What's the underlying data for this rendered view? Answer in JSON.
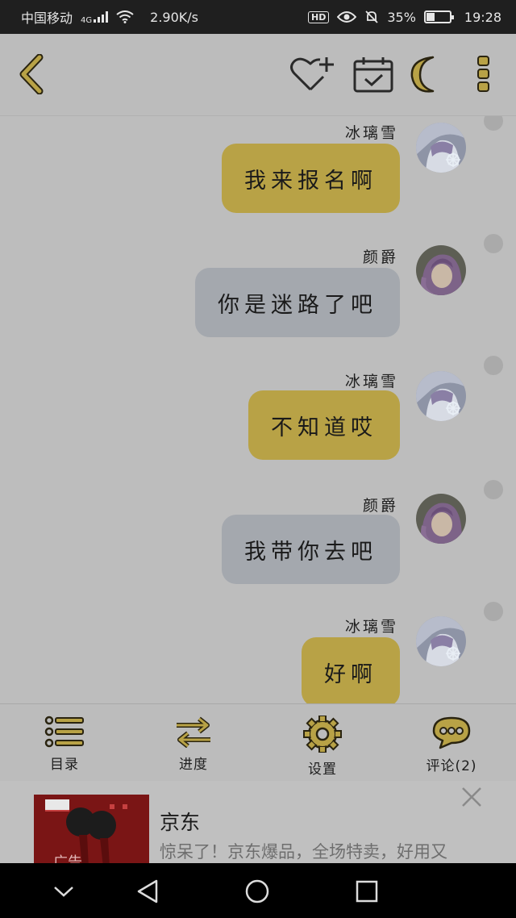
{
  "status_bar": {
    "carrier": "中国移动",
    "network": "4G",
    "speed": "2.90K/s",
    "hd": "HD",
    "battery_percent": "35%",
    "battery_level": 0.35,
    "time": "19:28"
  },
  "toolbar": {
    "icons": [
      "back-chevron-icon",
      "heart-plus-icon",
      "calendar-check-icon",
      "moon-icon",
      "more-vertical-icon"
    ]
  },
  "messages": [
    {
      "sender": "冰璃雪",
      "text": "我来报名啊",
      "side": "me",
      "unread": true
    },
    {
      "sender": "颜爵",
      "text": "你是迷路了吧",
      "side": "other",
      "unread": true
    },
    {
      "sender": "冰璃雪",
      "text": "不知道哎",
      "side": "me",
      "unread": true
    },
    {
      "sender": "颜爵",
      "text": "我带你去吧",
      "side": "other",
      "unread": true
    },
    {
      "sender": "冰璃雪",
      "text": "好啊",
      "side": "me",
      "unread": true
    }
  ],
  "bottom_nav": {
    "items": [
      {
        "label": "目录",
        "icon": "list-icon"
      },
      {
        "label": "进度",
        "icon": "swap-arrows-icon"
      },
      {
        "label": "设置",
        "icon": "gear-icon"
      },
      {
        "label": "评论(2)",
        "icon": "comment-bubble-icon"
      }
    ]
  },
  "ad": {
    "title": "京东",
    "description": "惊呆了！京东爆品，全场特卖，好用又",
    "image_caption": "广告"
  },
  "colors": {
    "accent": "#b8a246",
    "bubble_other": "#a4a8ae",
    "background": "#bdbdbd",
    "status_bar": "#1f1f1f"
  }
}
